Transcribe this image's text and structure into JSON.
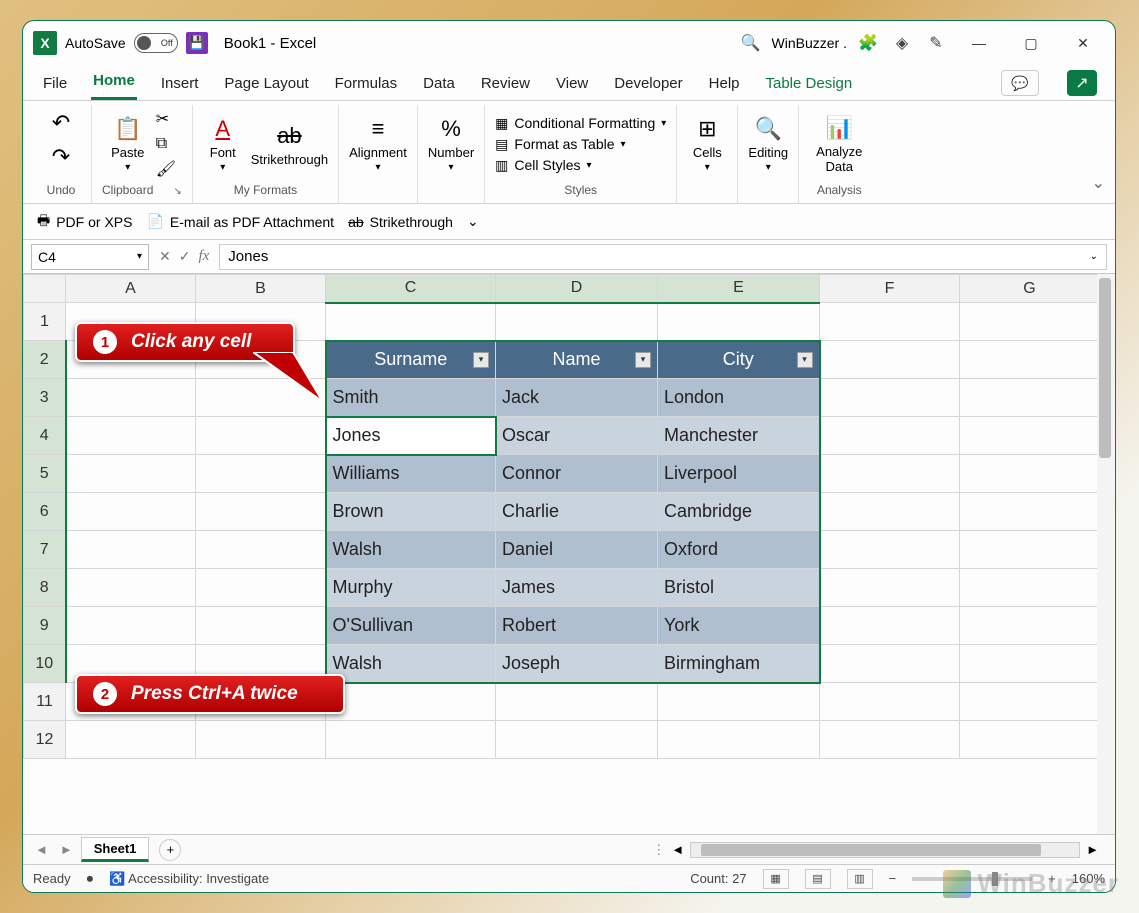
{
  "titlebar": {
    "autosave_label": "AutoSave",
    "autosave_state": "Off",
    "doc_title": "Book1  -  Excel",
    "account": "WinBuzzer ."
  },
  "tabs": {
    "file": "File",
    "home": "Home",
    "insert": "Insert",
    "page_layout": "Page Layout",
    "formulas": "Formulas",
    "data": "Data",
    "review": "Review",
    "view": "View",
    "developer": "Developer",
    "help": "Help",
    "table_design": "Table Design"
  },
  "ribbon": {
    "undo": {
      "label": "Undo"
    },
    "clipboard": {
      "label": "Clipboard",
      "paste": "Paste"
    },
    "myformats": {
      "label": "My Formats",
      "font": "Font",
      "strike": "Strikethrough"
    },
    "alignment": "Alignment",
    "number": "Number",
    "styles": {
      "label": "Styles",
      "cond": "Conditional Formatting",
      "fmt_table": "Format as Table",
      "cell_styles": "Cell Styles"
    },
    "cells": "Cells",
    "editing": "Editing",
    "analysis": {
      "label": "Analysis",
      "analyze": "Analyze Data"
    }
  },
  "qat": {
    "pdf": "PDF or XPS",
    "email_pdf": "E-mail as PDF Attachment",
    "strike": "Strikethrough"
  },
  "fbar": {
    "namebox": "C4",
    "formula": "Jones"
  },
  "columns": [
    "A",
    "B",
    "C",
    "D",
    "E",
    "F",
    "G"
  ],
  "rows": [
    "1",
    "2",
    "3",
    "4",
    "5",
    "6",
    "7",
    "8",
    "9",
    "10",
    "11",
    "12"
  ],
  "table": {
    "headers": [
      "Surname",
      "Name",
      "City"
    ],
    "data": [
      [
        "Smith",
        "Jack",
        "London"
      ],
      [
        "Jones",
        "Oscar",
        "Manchester"
      ],
      [
        "Williams",
        "Connor",
        "Liverpool"
      ],
      [
        "Brown",
        "Charlie",
        "Cambridge"
      ],
      [
        "Walsh",
        "Daniel",
        "Oxford"
      ],
      [
        "Murphy",
        "James",
        "Bristol"
      ],
      [
        "O'Sullivan",
        "Robert",
        "York"
      ],
      [
        "Walsh",
        "Joseph",
        "Birmingham"
      ]
    ]
  },
  "callouts": {
    "c1_num": "1",
    "c1_text": "Click any cell",
    "c2_num": "2",
    "c2_text": "Press Ctrl+A twice"
  },
  "sheets": {
    "sheet1": "Sheet1"
  },
  "statusbar": {
    "ready": "Ready",
    "accessibility": "Accessibility: Investigate",
    "count": "Count: 27",
    "zoom": "160%"
  },
  "watermark": "WinBuzzer",
  "chart_data": {
    "type": "table",
    "title": "",
    "columns": [
      "Surname",
      "Name",
      "City"
    ],
    "rows": [
      [
        "Smith",
        "Jack",
        "London"
      ],
      [
        "Jones",
        "Oscar",
        "Manchester"
      ],
      [
        "Williams",
        "Connor",
        "Liverpool"
      ],
      [
        "Brown",
        "Charlie",
        "Cambridge"
      ],
      [
        "Walsh",
        "Daniel",
        "Oxford"
      ],
      [
        "Murphy",
        "James",
        "Bristol"
      ],
      [
        "O'Sullivan",
        "Robert",
        "York"
      ],
      [
        "Walsh",
        "Joseph",
        "Birmingham"
      ]
    ]
  }
}
